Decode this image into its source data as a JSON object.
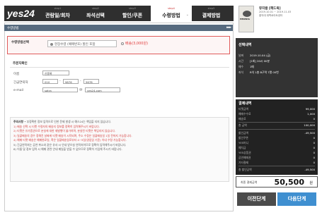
{
  "logo": "yes24",
  "steps": [
    {
      "num": "step1",
      "label": "관람일/회차"
    },
    {
      "num": "step2",
      "label": "좌석선택"
    },
    {
      "num": "step3",
      "label": "할인/쿠폰"
    },
    {
      "num": "step4",
      "label": "수령방법"
    },
    {
      "num": "step5",
      "label": "결제방법"
    }
  ],
  "section": {
    "title": "수령방법",
    "arrows": "▸▸▸▸"
  },
  "receive": {
    "label": "수령방법선택",
    "option1": "현장수령 (예매번호) 할인 포함",
    "option2": "배송(3,000원)"
  },
  "orderer": {
    "title": "주문자확인",
    "name_label": "이름",
    "name_value": "신용록",
    "phone_label": "긴급연락처",
    "phone1": "010",
    "phone2": "9876",
    "phone3": "5678",
    "email_label": "e-mail",
    "email_user": "satra",
    "email_domain": "yes24.com"
  },
  "notice": {
    "title": "주의사항",
    "intro": "• 부정확한 정보 입력으로 인한 문제 발생 시 예스24는 책임을 지지 않습니다.",
    "lines": [
      "1) 배송 선택 시 티켓 수령자의 배송지 정보를 정확히 입력해주시기 바랍니다.",
      "2) 티켓은 유가증권으로 분실에 대한 재발행이 불가하며, 분실된 티켓은 책임지지 않습니다.",
      "3) 일괄배송의 경우 정해진 날짜에 티켓 배송이 시작되며, 주소 수정은 일괄배송일 1일 전까지 가능합니다.",
      "4) 예매 티켓 배송은 예매완료일, 혹은 일괄배송일로부터 4~5일(영업일 기준) 이내 수령 가능합니다.",
      "5) 긴급연락처는 공연 취소와 같은 유사 시 안내 받으실 연락처이므로 정확히 입력해주시기 바랍니다.",
      "6) 이름 및 정보 입력 시 예매 관련 안내 메일을 받을 수 없으므로 정확히 기입해 주시기 바랍니다."
    ]
  },
  "product": {
    "title": "뮤지컬 [헤드윅]",
    "line1": "2019.10.01 ~ 2019.11.03",
    "line2": "홍익대 대학로아트센터",
    "poster_text": "HEDWIG"
  },
  "selection": {
    "title": "선택내역",
    "rows": [
      {
        "label": "날짜",
        "value": "2019.10.04 (금)"
      },
      {
        "label": "시간",
        "value": "[1회] 20시 00분"
      },
      {
        "label": "매수",
        "value": "1매"
      },
      {
        "label": "좌석",
        "value": "R석 1층 B구역 7열 00번"
      }
    ]
  },
  "billing": {
    "title": "결제내역",
    "rows": [
      {
        "label": "티켓금액",
        "value": "99,000"
      },
      {
        "label": "예매수수료",
        "value": "1,000"
      },
      {
        "label": "배송료",
        "value": "0"
      },
      {
        "label": "총 금액",
        "value": "100,000"
      },
      {
        "label": "할인금액",
        "value": "-49,500"
      },
      {
        "label": "할인쿠폰",
        "value": "0"
      },
      {
        "label": "YES머니",
        "value": "0"
      },
      {
        "label": "예치금",
        "value": "0"
      },
      {
        "label": "YES상품권",
        "value": "0"
      },
      {
        "label": "공연예매권",
        "value": "0"
      },
      {
        "label": "기타결제",
        "value": "0"
      },
      {
        "label": "총 할인금액",
        "value": "-49,500"
      }
    ]
  },
  "total": {
    "label": "최종 결제금액",
    "value": "50,500",
    "unit": "원"
  },
  "buttons": {
    "prev": "이전단계",
    "next": "다음단계"
  }
}
